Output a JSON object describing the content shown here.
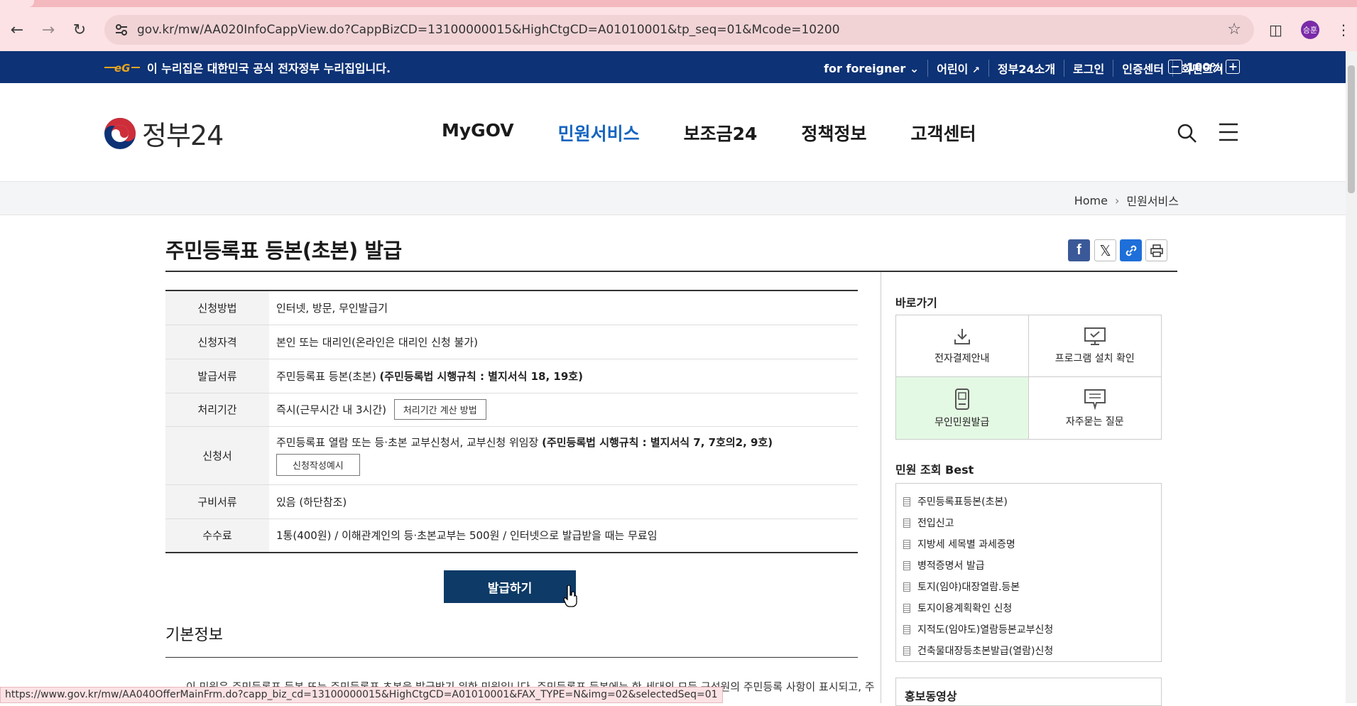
{
  "browser": {
    "url": "gov.kr/mw/AA020InfoCappView.do?CappBizCD=13100000015&HighCtgCD=A01010001&tp_seq=01&Mcode=10200",
    "profile_initials": "승훈",
    "status_url": "https://www.gov.kr/mw/AA040OfferMainFrm.do?capp_biz_cd=13100000015&HighCtgCD=A01010001&FAX_TYPE=N&img=02&selectedSeq=01"
  },
  "govbar": {
    "notice": "이 누리집은 대한민국 공식 전자정부 누리집입니다.",
    "links": [
      "for foreigner",
      "어린이",
      "정부24소개",
      "로그인",
      "인증센터",
      "화면크기"
    ],
    "zoom": "100%"
  },
  "header": {
    "logo_text": "정부24",
    "nav": [
      "MyGOV",
      "민원서비스",
      "보조금24",
      "정책정보",
      "고객센터"
    ],
    "active_nav": "민원서비스"
  },
  "breadcrumb": {
    "home": "Home",
    "current": "민원서비스"
  },
  "page": {
    "title": "주민등록표 등본(초본) 발급"
  },
  "info": {
    "rows": [
      {
        "label": "신청방법",
        "value": "인터넷, 방문, 무인발급기"
      },
      {
        "label": "신청자격",
        "value": "본인 또는 대리인(온라인은 대리인 신청 불가)"
      },
      {
        "label": "발급서류",
        "value": "주민등록표 등본(초본) ",
        "bold": "(주민등록법 시행규칙 : 별지서식 18, 19호)"
      },
      {
        "label": "처리기간",
        "value": "즉시(근무시간 내 3시간)",
        "button": "처리기간 계산 방법"
      },
      {
        "label": "신청서",
        "value": "주민등록표 열람 또는 등·초본 교부신청서, 교부신청 위임장 ",
        "bold": "(주민등록법 시행규칙 : 별지서식 7, 7호의2, 9호)",
        "button": "신청작성예시"
      },
      {
        "label": "구비서류",
        "value": "있음 (하단참조)"
      },
      {
        "label": "수수료",
        "value": "1통(400원) / 이해관계인의 등·초본교부는 500원 / 인터넷으로 발급받을 때는 무료임"
      }
    ]
  },
  "issue_button": "발급하기",
  "basic_info": {
    "title": "기본정보",
    "text": "이 민원은 주민등록표 등본 또는 주민등록표 초본을 발급받기 위한 민원입니다. 주민등록표 등본에는 한 세대의 모든 구성원의 주민등록 사항이 표시되고, 주"
  },
  "sidebar": {
    "quick_title": "바로가기",
    "quick": [
      {
        "label": "전자결제안내",
        "icon": "download-icon"
      },
      {
        "label": "프로그램 설치 확인",
        "icon": "monitor-check-icon"
      },
      {
        "label": "무인민원발급",
        "icon": "kiosk-icon"
      },
      {
        "label": "자주묻는 질문",
        "icon": "chat-icon"
      }
    ],
    "best_title": "민원 조회 Best",
    "best": [
      "주민등록표등본(초본)",
      "전입신고",
      "지방세 세목별 과세증명",
      "병적증명서 발급",
      "토지(임야)대장열람.등본",
      "토지이용계획확인 신청",
      "지적도(임야도)열람등본교부신청",
      "건축물대장등초본발급(열람)신청"
    ],
    "promo_title": "홍보동영상"
  }
}
